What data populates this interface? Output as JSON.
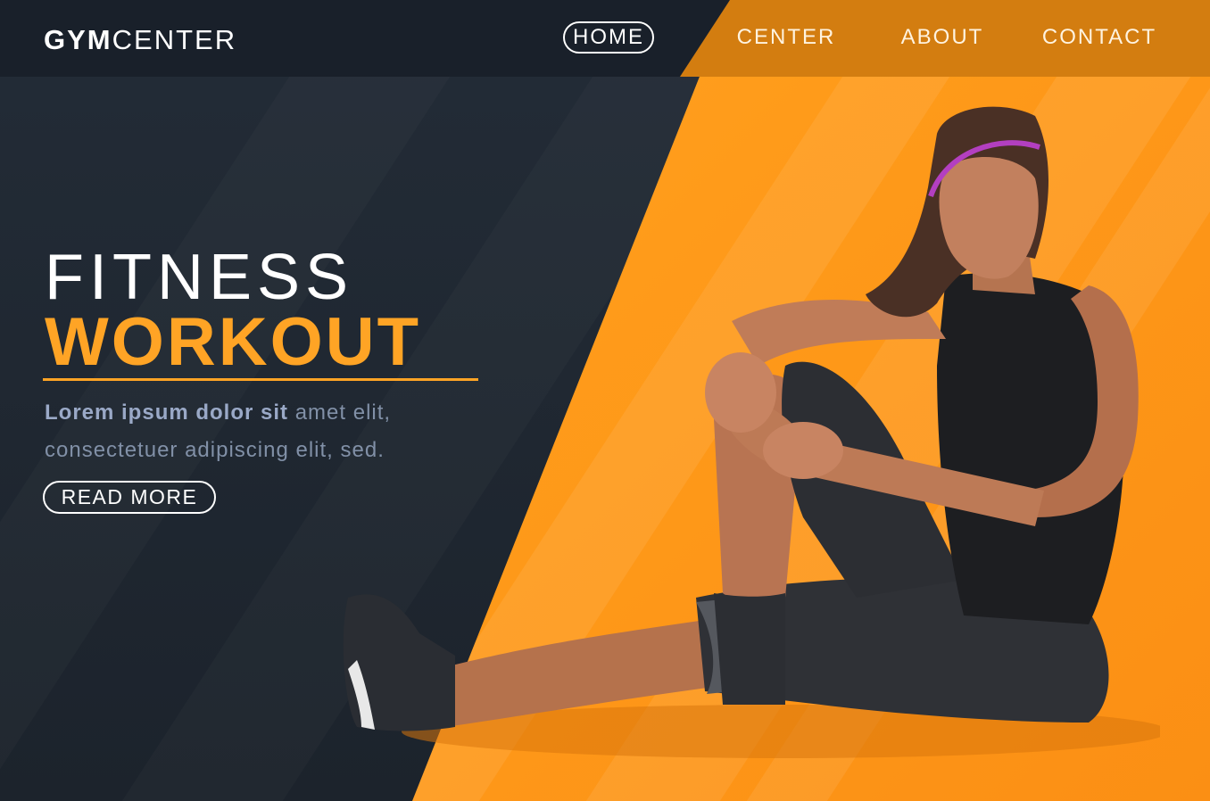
{
  "brand": {
    "logo_bold": "GYM",
    "logo_light": "CENTER"
  },
  "nav": {
    "home": "HOME",
    "center": "CENTER",
    "about": "ABOUT",
    "contact": "CONTACT"
  },
  "hero": {
    "title_line1": "FITNESS",
    "title_line2": "WORKOUT",
    "desc_strong": "Lorem ipsum dolor sit",
    "desc_rest": " amet elit, consectetuer adipiscing elit, sed.",
    "cta": "READ MORE"
  },
  "colors": {
    "accent": "#ffa425",
    "dark_bg": "#1e2530",
    "orange_bg": "#ff9b1a"
  }
}
